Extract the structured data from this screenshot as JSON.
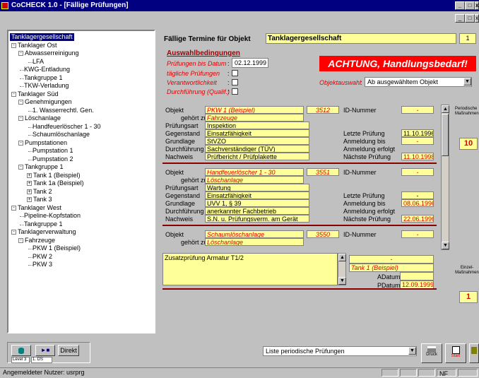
{
  "window": {
    "title": "CoCHECK 1.0 - [Fällige Prüfungen]",
    "controls": [
      "_",
      "□",
      "x"
    ],
    "mdi_controls": [
      "_",
      "□",
      "x"
    ]
  },
  "tree": {
    "items": [
      {
        "label": "Tanklagergesellschaft",
        "level": 0,
        "toggle": "",
        "selected": true
      },
      {
        "label": "Tanklager Ost",
        "level": 0,
        "toggle": "-"
      },
      {
        "label": "Abwasserreinigung",
        "level": 1,
        "toggle": "-"
      },
      {
        "label": "LFA",
        "level": 2,
        "toggle": ""
      },
      {
        "label": "KWG-Entladung",
        "level": 1,
        "toggle": ""
      },
      {
        "label": "Tankgruppe 1",
        "level": 1,
        "toggle": ""
      },
      {
        "label": "TKW-Verladung",
        "level": 1,
        "toggle": ""
      },
      {
        "label": "Tanklager Süd",
        "level": 0,
        "toggle": "-"
      },
      {
        "label": "Genehmigungen",
        "level": 1,
        "toggle": "-"
      },
      {
        "label": "1. Wasserrechtl. Gen.",
        "level": 2,
        "toggle": ""
      },
      {
        "label": "Löschanlage",
        "level": 1,
        "toggle": "-"
      },
      {
        "label": "Handfeuerlöscher 1 - 30",
        "level": 2,
        "toggle": ""
      },
      {
        "label": "Schaumlöschanlage",
        "level": 2,
        "toggle": ""
      },
      {
        "label": "Pumpstationen",
        "level": 1,
        "toggle": "-"
      },
      {
        "label": "Pumpstation 1",
        "level": 2,
        "toggle": ""
      },
      {
        "label": "Pumpstation 2",
        "level": 2,
        "toggle": ""
      },
      {
        "label": "Tankgruppe 1",
        "level": 1,
        "toggle": "-"
      },
      {
        "label": "Tank 1 (Beispiel)",
        "level": 2,
        "toggle": "+"
      },
      {
        "label": "Tank 1a (Beispiel)",
        "level": 2,
        "toggle": "+"
      },
      {
        "label": "Tank 2",
        "level": 2,
        "toggle": "+"
      },
      {
        "label": "Tank 3",
        "level": 2,
        "toggle": "+"
      },
      {
        "label": "Tanklager West",
        "level": 0,
        "toggle": "-"
      },
      {
        "label": "Pipeline-Kopfstation",
        "level": 1,
        "toggle": ""
      },
      {
        "label": "Tankgruppe 1",
        "level": 1,
        "toggle": ""
      },
      {
        "label": "Tanklagerverwaltung",
        "level": 0,
        "toggle": "-"
      },
      {
        "label": "Fahrzeuge",
        "level": 1,
        "toggle": "-"
      },
      {
        "label": "PKW 1 (Beispiel)",
        "level": 2,
        "toggle": ""
      },
      {
        "label": "PKW 2",
        "level": 2,
        "toggle": ""
      },
      {
        "label": "PKW 3",
        "level": 2,
        "toggle": ""
      }
    ]
  },
  "header": {
    "label": "Fällige Termine für Objekt",
    "object": "Tanklagergesellschaft",
    "count": "1"
  },
  "filter": {
    "title": "Auswahlbedingungen",
    "due_label": "Prüfungen bis Datum",
    "due_value": "02.12.1999",
    "daily_label": "tägliche Prüfungen",
    "resp_label": "Verantwortlichkeit",
    "qual_label": "Durchführung (Qualif.)",
    "alert": "ACHTUNG, Handlungsbedarf!",
    "object_select_label": "Objektauswahl",
    "object_select_value": "Ab ausgewähltem Objekt"
  },
  "labels": {
    "objekt": "Objekt",
    "gehoert_zu": "gehört zu",
    "pruefungsart": "Prüfungsart",
    "gegenstand": "Gegenstand",
    "grundlage": "Grundlage",
    "durchfuehrung": "Durchführung",
    "nachweis": "Nachweis",
    "id_nummer": "ID-Nummer",
    "letzte_pruefung": "Letzte Prüfung",
    "anmeldung_bis": "Anmeldung bis",
    "anmeldung_erfolgt": "Anmeldung erfolgt",
    "naechste_pruefung": "Nächste Prüfung"
  },
  "records": [
    {
      "objekt": "PKW 1 (Beispiel)",
      "nr": "3512",
      "id": "-",
      "gehoert_zu": "Fahrzeuge",
      "pruefungsart": "Inspektion",
      "gegenstand": "Einsatzfähigkeit",
      "grundlage": "StVZO",
      "durchfuehrung": "Sachverständiger (TÜV)",
      "nachweis": "Prüfbericht / Prüfplakette",
      "letzte": "11.10.1996",
      "anmeldung_bis": "-",
      "naechste": "11.10.1998"
    },
    {
      "objekt": "Handfeuerlöscher 1 - 30",
      "nr": "3551",
      "id": "-",
      "gehoert_zu": "Löschanlage",
      "pruefungsart": "Wartung",
      "gegenstand": "Einsatzfähigkeit",
      "grundlage": "UVV 1, § 39",
      "durchfuehrung": "anerkannter Fachbetrieb",
      "nachweis": "S.N. u. Prüfungsverm. am Gerät",
      "letzte": "-",
      "anmeldung_bis": "08.06.1996",
      "naechste": "22.06.1996"
    },
    {
      "objekt": "Schaumlöschanlage",
      "nr": "3550",
      "id": "-",
      "gehoert_zu": "Löschanlage"
    }
  ],
  "right_panel": {
    "periodic_label_1": "Periodische",
    "periodic_label_2": "Maßnahmen",
    "periodic_count": "10",
    "single_label_1": "Einzel-",
    "single_label_2": "Maßnahmen",
    "single_count": "1"
  },
  "extra": {
    "note": "Zusatzprüfung Armatur T1/2",
    "dash": "-",
    "object": "Tank 1 (Beispiel)",
    "adatum_label": "ADatum",
    "adatum_value": "",
    "pdatum_label": "PDatum",
    "pdatum_value": "12.09.1999"
  },
  "bottom": {
    "direkt": "Direkt",
    "level_label": "Level 3",
    "level_value": "1. DS",
    "report_select": "Liste periodische Prüfungen",
    "druck": "Druck",
    "start": "Start"
  },
  "status": {
    "user": "Angemeldeter Nutzer: usrprg",
    "nf": "NF"
  },
  "colors": {
    "title_bar": "#000080",
    "field_yellow": "#ffff99",
    "alert_red": "#ff0000",
    "italic_red": "#e00000",
    "separator": "#8b0000"
  }
}
